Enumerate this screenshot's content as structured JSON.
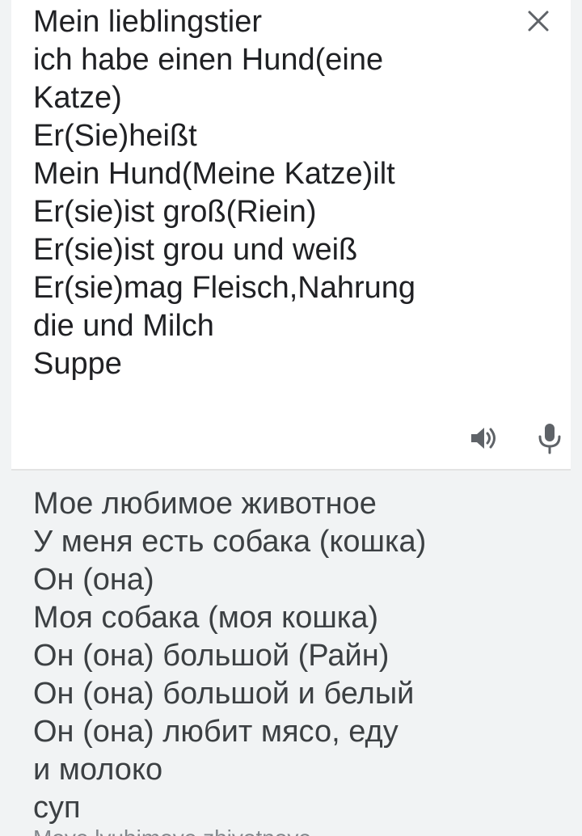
{
  "source": {
    "lines": [
      "Mein lieblingstier",
      "ich habe einen Hund(eine",
      "Katze)",
      "Er(Sie)heißt",
      "Mein Hund(Meine Katze)ilt",
      "Er(sie)ist groß(Riein)",
      "Er(sie)ist grou und weiß",
      "Er(sie)mag Fleisch,Nahrung",
      "die und Milch",
      "Suppe"
    ],
    "close_icon": "close-icon",
    "speaker_icon": "speaker-icon",
    "mic_icon": "microphone-icon"
  },
  "translation": {
    "lines": [
      "Мое любимое животное",
      "У меня есть собака (кошка)",
      "Он (она)",
      "Моя собака (моя кошка)",
      "Он (она) большой (Райн)",
      "Он (она) большой и белый",
      "Он (она) любит мясо, еду",
      "и молоко",
      "суп"
    ],
    "transliteration": "Moye lyubimoye zhivotnoye"
  },
  "colors": {
    "background": "#f1f3f4",
    "card": "#ffffff",
    "source_text": "#202124",
    "translation_text": "#3c4043",
    "icon": "#5f6368"
  }
}
